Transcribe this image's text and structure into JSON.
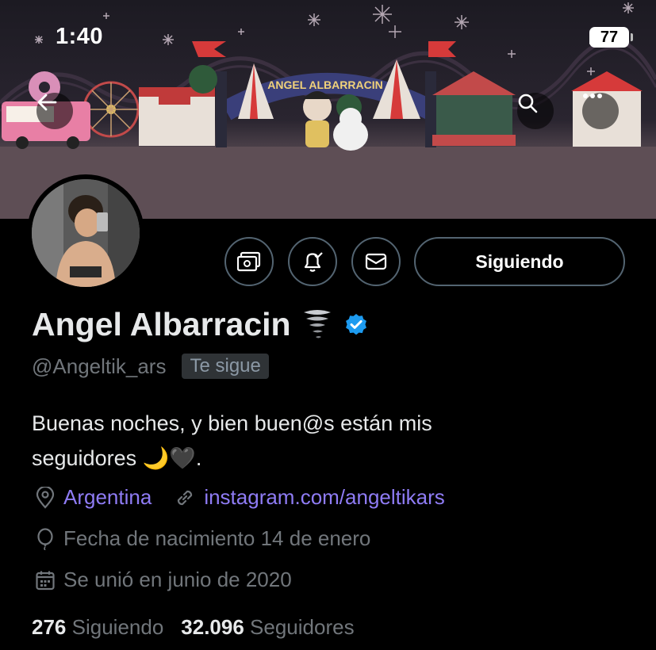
{
  "status_bar": {
    "time": "1:40",
    "battery": "77"
  },
  "banner": {
    "sign_text": "ANGEL ALBARRACIN"
  },
  "profile": {
    "name": "Angel Albarracin",
    "handle": "@Angeltik_ars",
    "follows_you_badge": "Te sigue",
    "bio_line1": "Buenas noches, y bien buen@s están mis",
    "bio_line2": "seguidores 🌙🖤.",
    "location": "Argentina",
    "website": "instagram.com/angeltikars",
    "birthday": "Fecha de nacimiento 14 de enero",
    "joined": "Se unió en junio de 2020"
  },
  "actions": {
    "follow_state": "Siguiendo"
  },
  "stats": {
    "following_count": "276",
    "following_label": "Siguiendo",
    "followers_count": "32.096",
    "followers_label": "Seguidores"
  },
  "colors": {
    "accent_link": "#8f7cf5",
    "verified": "#1d9bf0",
    "muted": "#71767b"
  },
  "icons": [
    "back-arrow-icon",
    "search-icon",
    "more-icon",
    "money-icon",
    "bell-check-icon",
    "mail-icon",
    "verified-badge-icon",
    "location-icon",
    "link-icon",
    "balloon-icon",
    "calendar-icon",
    "tornado-emoji"
  ]
}
